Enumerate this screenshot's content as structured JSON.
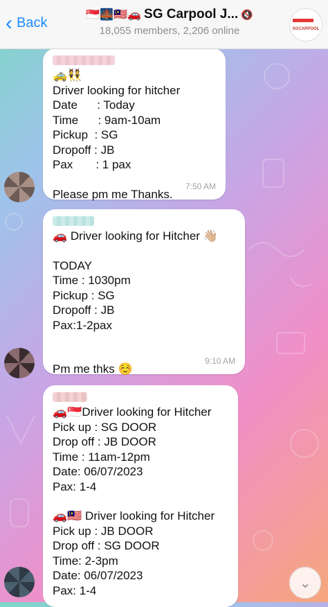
{
  "header": {
    "back_label": "Back",
    "flags": "🇸🇬🌉🇲🇾🚗",
    "title": "SG Carpool J...",
    "subtitle": "18,055 members, 2,206 online",
    "avatar_text": "SGCARPOOL"
  },
  "messages": [
    {
      "emoji": "🚕👯",
      "lines": [
        "Driver looking for hitcher",
        "Date      : Today",
        "Time      : 9am-10am",
        "Pickup  : SG",
        "Dropoff : JB",
        "Pax       : 1 pax",
        "",
        "Please pm me Thanks."
      ],
      "time": "7:50 AM"
    },
    {
      "lines": [
        "🚗 Driver looking for Hitcher 👋🏼",
        "",
        "TODAY",
        "Time : 1030pm",
        "Pickup : SG",
        "Dropoff : JB",
        "Pax:1-2pax",
        "",
        "",
        "Pm me thks ☺️"
      ],
      "time": "9:10 AM"
    },
    {
      "lines": [
        "🚗🇸🇬Driver looking for Hitcher",
        "Pick up : SG DOOR",
        "Drop off : JB DOOR",
        "Time : 11am-12pm",
        "Date: 06/07/2023",
        "Pax: 1-4",
        "",
        "🚗🇲🇾 Driver looking for Hitcher",
        "Pick up : JB DOOR",
        "Drop off : SG DOOR",
        "Time: 2-3pm",
        "Date: 06/07/2023",
        "Pax: 1-4"
      ]
    }
  ],
  "scroll_icon": "chevron-down-icon"
}
